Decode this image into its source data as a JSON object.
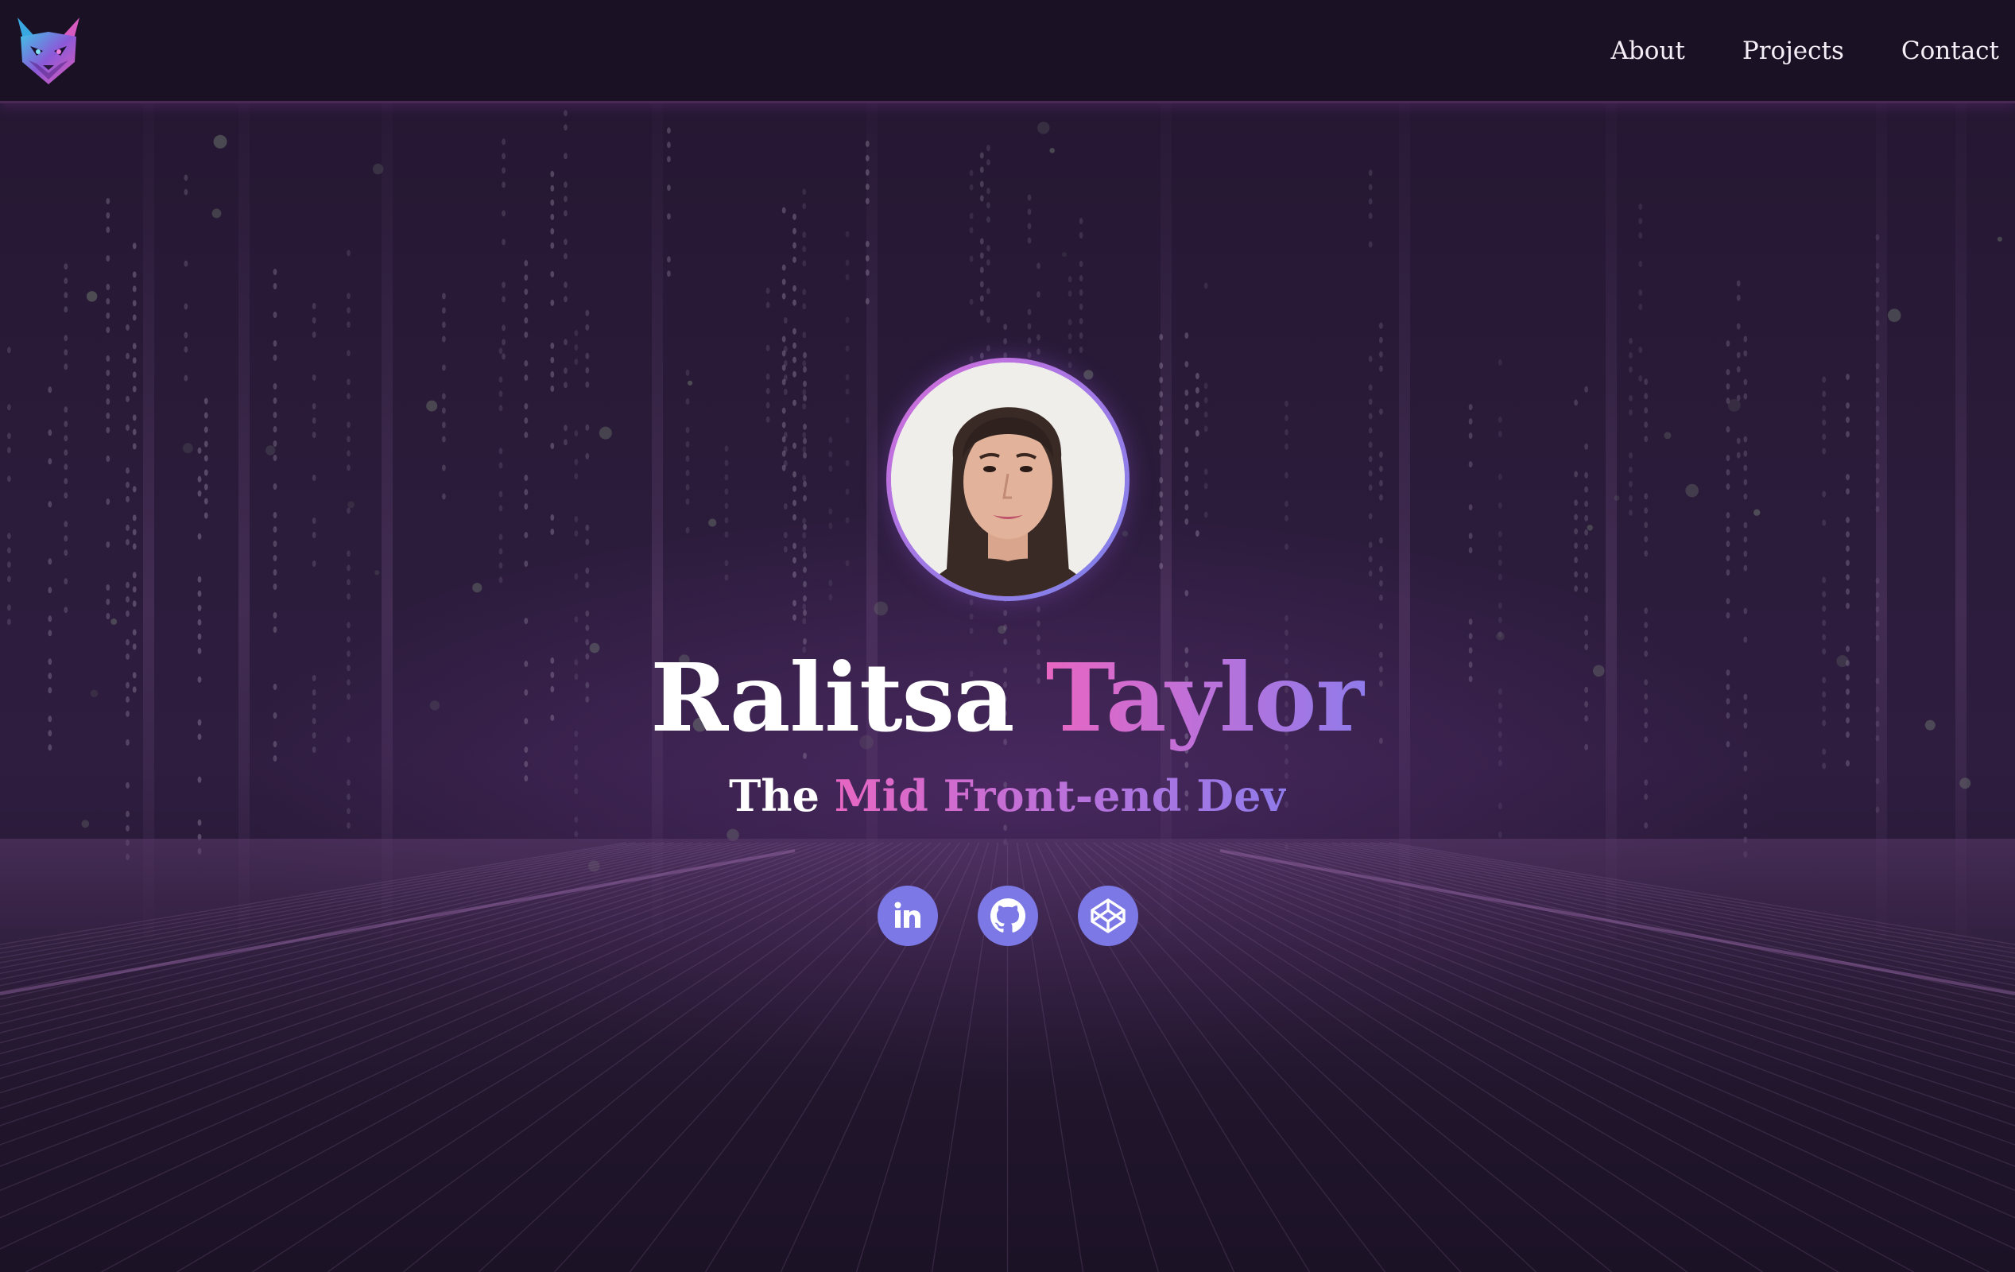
{
  "header": {
    "logo_icon": "fox-logo-icon",
    "nav": [
      {
        "label": "About"
      },
      {
        "label": "Projects"
      },
      {
        "label": "Contact"
      }
    ]
  },
  "hero": {
    "avatar_icon": "profile-photo",
    "name": {
      "first": "Ralitsa",
      "last": "Taylor"
    },
    "tagline": {
      "lead": "The",
      "highlight": "Mid Front-end Dev"
    },
    "socials": [
      {
        "name": "linkedin-icon"
      },
      {
        "name": "github-icon"
      },
      {
        "name": "codepen-icon"
      }
    ]
  },
  "colors": {
    "background": "#1d1327",
    "header": "#1a1223",
    "gradient_start": "#e766c2",
    "gradient_end": "#8f7bea",
    "social_bg": "#7c78e6",
    "text": "#ffffff"
  }
}
